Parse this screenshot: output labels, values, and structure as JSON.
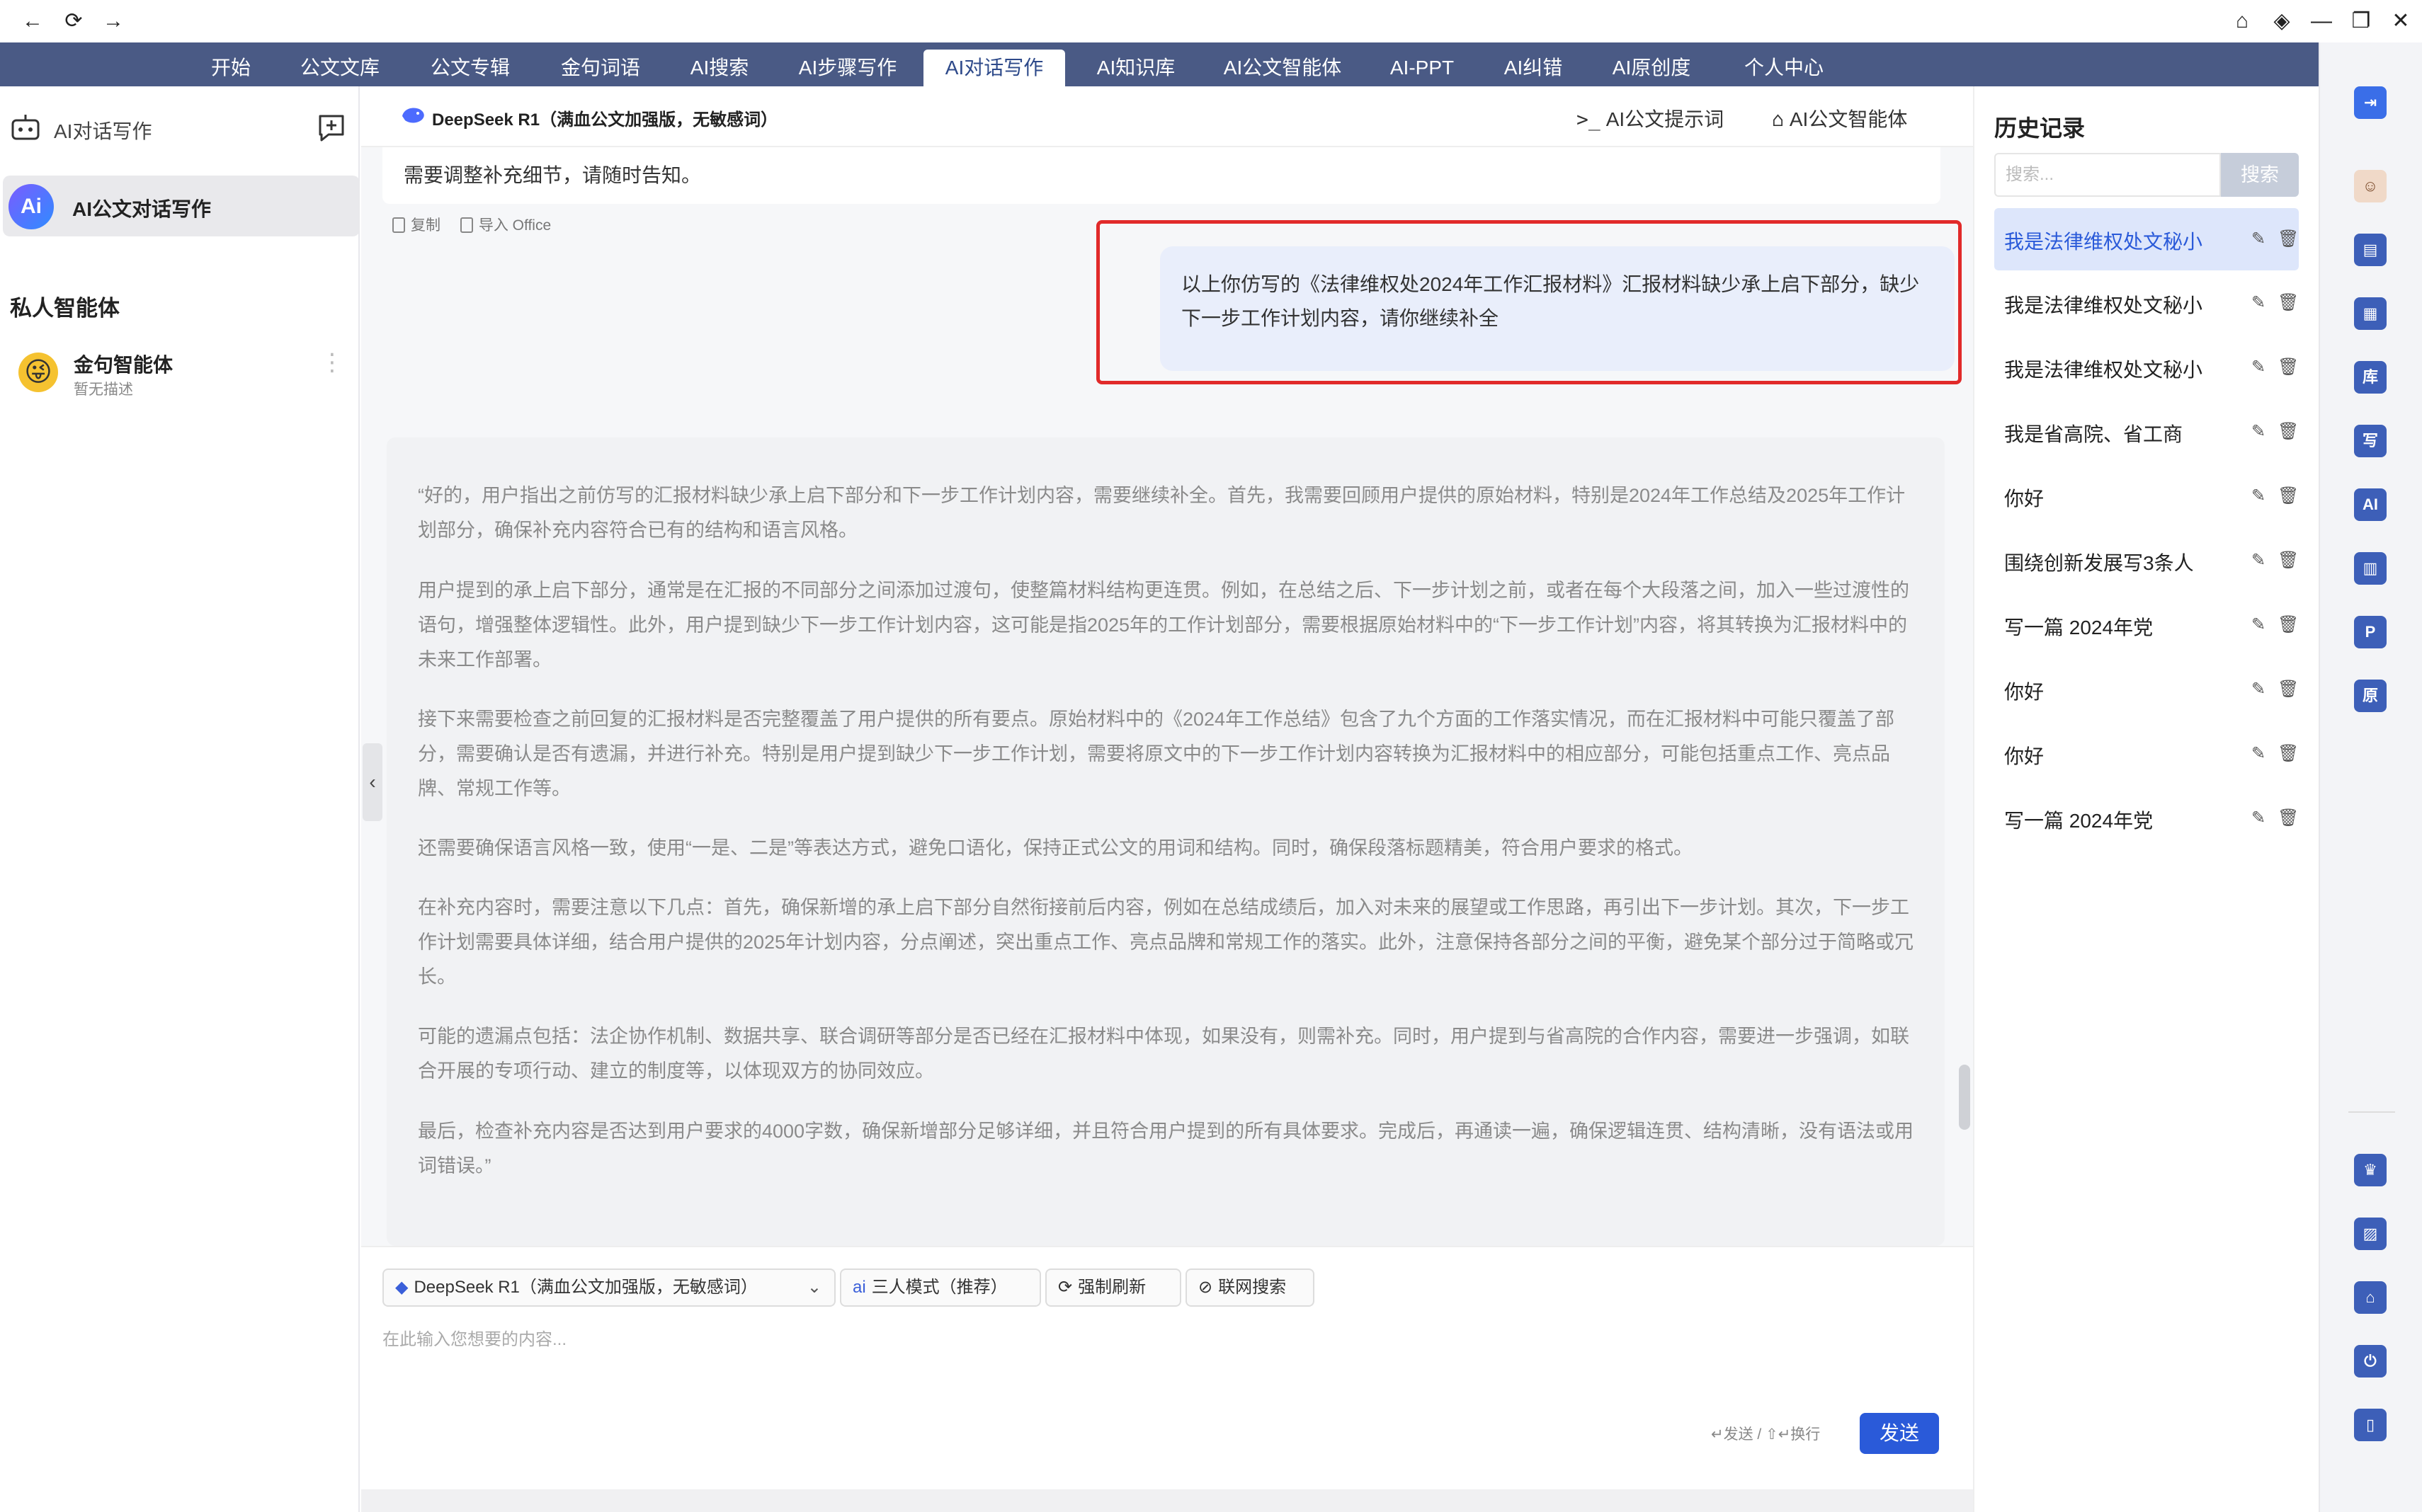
{
  "window": {
    "back": "←",
    "refresh": "⟳",
    "forward": "→",
    "home": "⌂",
    "pin": "◈",
    "minimize": "—",
    "restore": "❐",
    "close": "✕"
  },
  "nav": {
    "tabs": [
      "开始",
      "公文文库",
      "公文专辑",
      "金句词语",
      "AI搜索",
      "AI步骤写作",
      "AI对话写作",
      "AI知识库",
      "AI公文智能体",
      "AI-PPT",
      "AI纠错",
      "AI原创度",
      "个人中心"
    ],
    "active_index": 6
  },
  "sidebar": {
    "title": "AI对话写作",
    "active_item": "AI公文对话写作",
    "active_logo": "Ai",
    "section_title": "私人智能体",
    "agent_name": "金句智能体",
    "agent_desc": "暂无描述",
    "agent_face": "😜",
    "more": "⋮"
  },
  "chat_header": {
    "model": "DeepSeek R1（满血公文加强版，无敏感词）",
    "prompt_btn": "AI公文提示词",
    "prompt_icon": ">_",
    "agent_btn": "AI公文智能体",
    "agent_icon": "⌂"
  },
  "chat": {
    "prev_message_tail": "需要调整补充细节，请随时告知。",
    "copy_label": "复制",
    "import_label": "导入 Office",
    "user_message": "以上你仿写的《法律维权处2024年工作汇报材料》汇报材料缺少承上启下部分，缺少 下一步工作计划内容，请你继续补全",
    "reasoning": [
      "“好的，用户指出之前仿写的汇报材料缺少承上启下部分和下一步工作计划内容，需要继续补全。首先，我需要回顾用户提供的原始材料，特别是2024年工作总结及2025年工作计划部分，确保补充内容符合已有的结构和语言风格。",
      "用户提到的承上启下部分，通常是在汇报的不同部分之间添加过渡句，使整篇材料结构更连贯。例如，在总结之后、下一步计划之前，或者在每个大段落之间，加入一些过渡性的语句，增强整体逻辑性。此外，用户提到缺少下一步工作计划内容，这可能是指2025年的工作计划部分，需要根据原始材料中的“下一步工作计划”内容，将其转换为汇报材料中的未来工作部署。",
      "接下来需要检查之前回复的汇报材料是否完整覆盖了用户提供的所有要点。原始材料中的《2024年工作总结》包含了九个方面的工作落实情况，而在汇报材料中可能只覆盖了部分，需要确认是否有遗漏，并进行补充。特别是用户提到缺少下一步工作计划，需要将原文中的下一步工作计划内容转换为汇报材料中的相应部分，可能包括重点工作、亮点品牌、常规工作等。",
      "还需要确保语言风格一致，使用“一是、二是”等表达方式，避免口语化，保持正式公文的用词和结构。同时，确保段落标题精美，符合用户要求的格式。",
      "在补充内容时，需要注意以下几点：首先，确保新增的承上启下部分自然衔接前后内容，例如在总结成绩后，加入对未来的展望或工作思路，再引出下一步计划。其次，下一步工作计划需要具体详细，结合用户提供的2025年计划内容，分点阐述，突出重点工作、亮点品牌和常规工作的落实。此外，注意保持各部分之间的平衡，避免某个部分过于简略或冗长。",
      "可能的遗漏点包括：法企协作机制、数据共享、联合调研等部分是否已经在汇报材料中体现，如果没有，则需补充。同时，用户提到与省高院的合作内容，需要进一步强调，如联合开展的专项行动、建立的制度等，以体现双方的协同效应。",
      "最后，检查补充内容是否达到用户要求的4000字数，确保新增部分足够详细，并且符合用户提到的所有具体要求。完成后，再通读一遍，确保逻辑连贯、结构清晰，没有语法或用词错误。”"
    ],
    "collapse": "‹"
  },
  "input": {
    "model_chip": "DeepSeek R1（满血公文加强版，无敏感词）",
    "mode_chip": "三人模式（推荐）",
    "refresh_chip": "强制刷新",
    "web_chip": "联网搜索",
    "placeholder": "在此输入您想要的内容...",
    "hint": "↵发送 / ⇧↵换行",
    "send": "发送"
  },
  "history": {
    "title": "历史记录",
    "search_placeholder": "搜索...",
    "search_btn": "搜索",
    "items": [
      "我是法律维权处文秘小",
      "我是法律维权处文秘小",
      "我是法律维权处文秘小",
      "我是省高院、省工商",
      "你好",
      "围绕创新发展写3条人",
      "写一篇 2024年党",
      "你好",
      "你好",
      "写一篇 2024年党"
    ],
    "active_index": 0,
    "edit_icon": "✎",
    "delete_icon": "🗑"
  },
  "rail": {
    "icons": [
      "exit-icon",
      "avatar-icon",
      "library-icon",
      "document-icon",
      "kb-icon",
      "write-icon",
      "ai-icon",
      "report-icon",
      "ppt-icon",
      "original-icon",
      "crown-icon",
      "chart-icon",
      "home-icon",
      "power-icon",
      "phone-icon"
    ],
    "glyphs": [
      "⇥",
      "☺",
      "▤",
      "▦",
      "库",
      "写",
      "AI",
      "▥",
      "P",
      "原",
      "♛",
      "▨",
      "⌂",
      "⏻",
      "▯"
    ],
    "colors": {
      "accent": "#3d5fb8",
      "send": "#2a5ad9",
      "highlight_border": "#e12a2a",
      "nav_bg": "#4a5a85"
    }
  }
}
